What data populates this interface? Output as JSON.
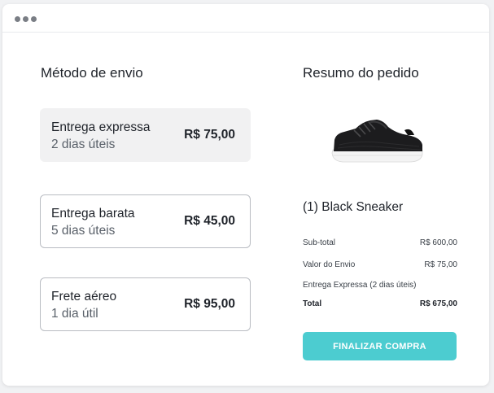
{
  "shipping": {
    "title": "Método de envio",
    "options": [
      {
        "name": "Entrega expressa",
        "days": "2 dias úteis",
        "price": "R$ 75,00",
        "selected": true
      },
      {
        "name": "Entrega barata",
        "days": "5 dias úteis",
        "price": "R$ 45,00",
        "selected": false
      },
      {
        "name": "Frete aéreo",
        "days": "1 dia útil",
        "price": "R$ 95,00",
        "selected": false
      }
    ]
  },
  "summary": {
    "title": "Resumo do pedido",
    "product_image": "black-sneaker-image",
    "product_name": "(1) Black Sneaker",
    "subtotal_label": "Sub-total",
    "subtotal_value": "R$ 600,00",
    "shipping_label": "Valor do Envio",
    "shipping_value": "R$ 75,00",
    "shipping_method_note": "Entrega Expressa (2 dias úteis)",
    "total_label": "Total",
    "total_value": "R$ 675,00",
    "checkout_label": "FINALIZAR COMPRA"
  },
  "colors": {
    "accent": "#4cccd0",
    "selected_bg": "#f1f1f2",
    "border": "#b9bcc2"
  }
}
